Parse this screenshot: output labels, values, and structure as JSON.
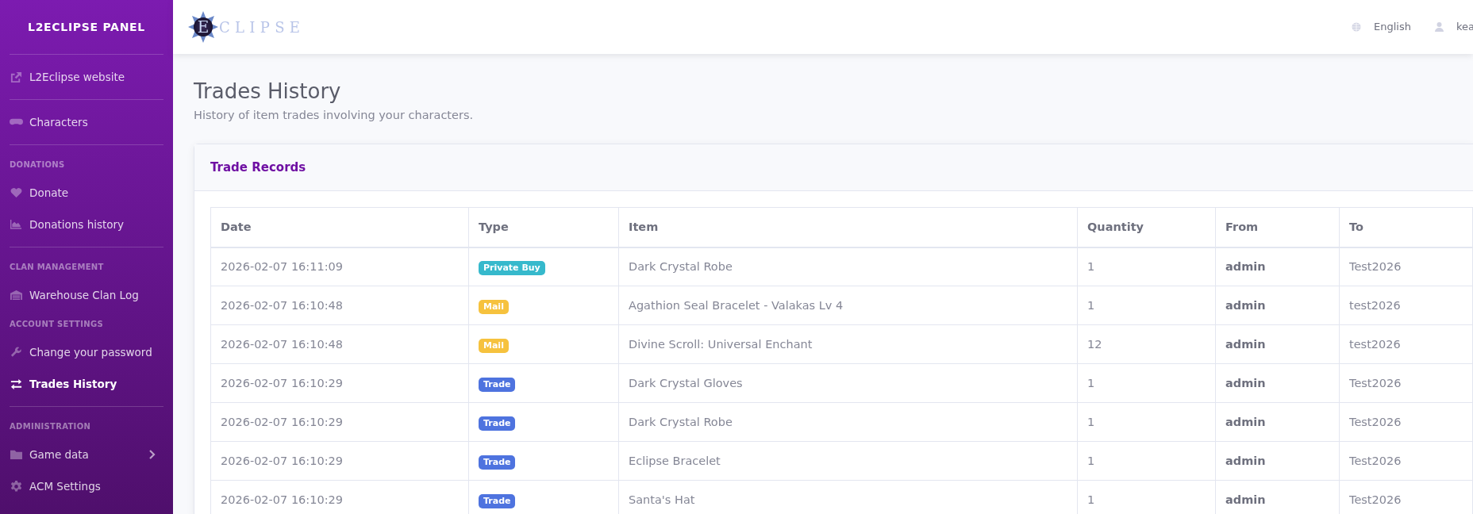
{
  "sidebar": {
    "brand": "L2ECLIPSE PANEL",
    "entries": [
      {
        "kind": "divider"
      },
      {
        "kind": "item",
        "label": "L2Eclipse website",
        "selected": false
      },
      {
        "kind": "divider"
      },
      {
        "kind": "item",
        "label": "Characters",
        "selected": false
      },
      {
        "kind": "divider"
      },
      {
        "kind": "heading",
        "label": "DONATIONS"
      },
      {
        "kind": "item",
        "label": "Donate",
        "selected": false
      },
      {
        "kind": "item",
        "label": "Donations history",
        "selected": false
      },
      {
        "kind": "divider"
      },
      {
        "kind": "heading",
        "label": "CLAN MANAGEMENT"
      },
      {
        "kind": "item",
        "label": "Warehouse Clan Log",
        "selected": false
      },
      {
        "kind": "heading",
        "label": "ACCOUNT SETTINGS"
      },
      {
        "kind": "item",
        "label": "Change your password",
        "selected": false
      },
      {
        "kind": "item",
        "label": "Trades History",
        "selected": true
      },
      {
        "kind": "divider"
      },
      {
        "kind": "heading",
        "label": "ADMINISTRATION"
      },
      {
        "kind": "item",
        "label": "Game data",
        "selected": false,
        "submenu": true
      },
      {
        "kind": "item",
        "label": "ACM Settings",
        "selected": false
      }
    ]
  },
  "topbar": {
    "logo": {
      "initial": "E",
      "text": "CLIPSE"
    },
    "language": "English",
    "user": "kea"
  },
  "page": {
    "title": "Trades History",
    "subtitle": "History of item trades involving your characters."
  },
  "card": {
    "title": "Trade Records",
    "table": {
      "columns": [
        "Date",
        "Type",
        "Item",
        "Quantity",
        "From",
        "To"
      ],
      "rows": [
        {
          "date": "2026-02-07 16:11:09",
          "type": {
            "label": "Private Buy",
            "color": "#36b9cc"
          },
          "item": "Dark Crystal Robe",
          "quantity": "1",
          "from": "admin",
          "to": "Test2026"
        },
        {
          "date": "2026-02-07 16:10:48",
          "type": {
            "label": "Mail",
            "color": "#f6c23e"
          },
          "item": "Agathion Seal Bracelet - Valakas Lv 4",
          "quantity": "1",
          "from": "admin",
          "to": "test2026"
        },
        {
          "date": "2026-02-07 16:10:48",
          "type": {
            "label": "Mail",
            "color": "#f6c23e"
          },
          "item": "Divine Scroll: Universal Enchant",
          "quantity": "12",
          "from": "admin",
          "to": "test2026"
        },
        {
          "date": "2026-02-07 16:10:29",
          "type": {
            "label": "Trade",
            "color": "#4e73df"
          },
          "item": "Dark Crystal Gloves",
          "quantity": "1",
          "from": "admin",
          "to": "Test2026"
        },
        {
          "date": "2026-02-07 16:10:29",
          "type": {
            "label": "Trade",
            "color": "#4e73df"
          },
          "item": "Dark Crystal Robe",
          "quantity": "1",
          "from": "admin",
          "to": "Test2026"
        },
        {
          "date": "2026-02-07 16:10:29",
          "type": {
            "label": "Trade",
            "color": "#4e73df"
          },
          "item": "Eclipse Bracelet",
          "quantity": "1",
          "from": "admin",
          "to": "Test2026"
        },
        {
          "date": "2026-02-07 16:10:29",
          "type": {
            "label": "Trade",
            "color": "#4e73df"
          },
          "item": "Santa's Hat",
          "quantity": "1",
          "from": "admin",
          "to": "Test2026"
        }
      ]
    }
  }
}
